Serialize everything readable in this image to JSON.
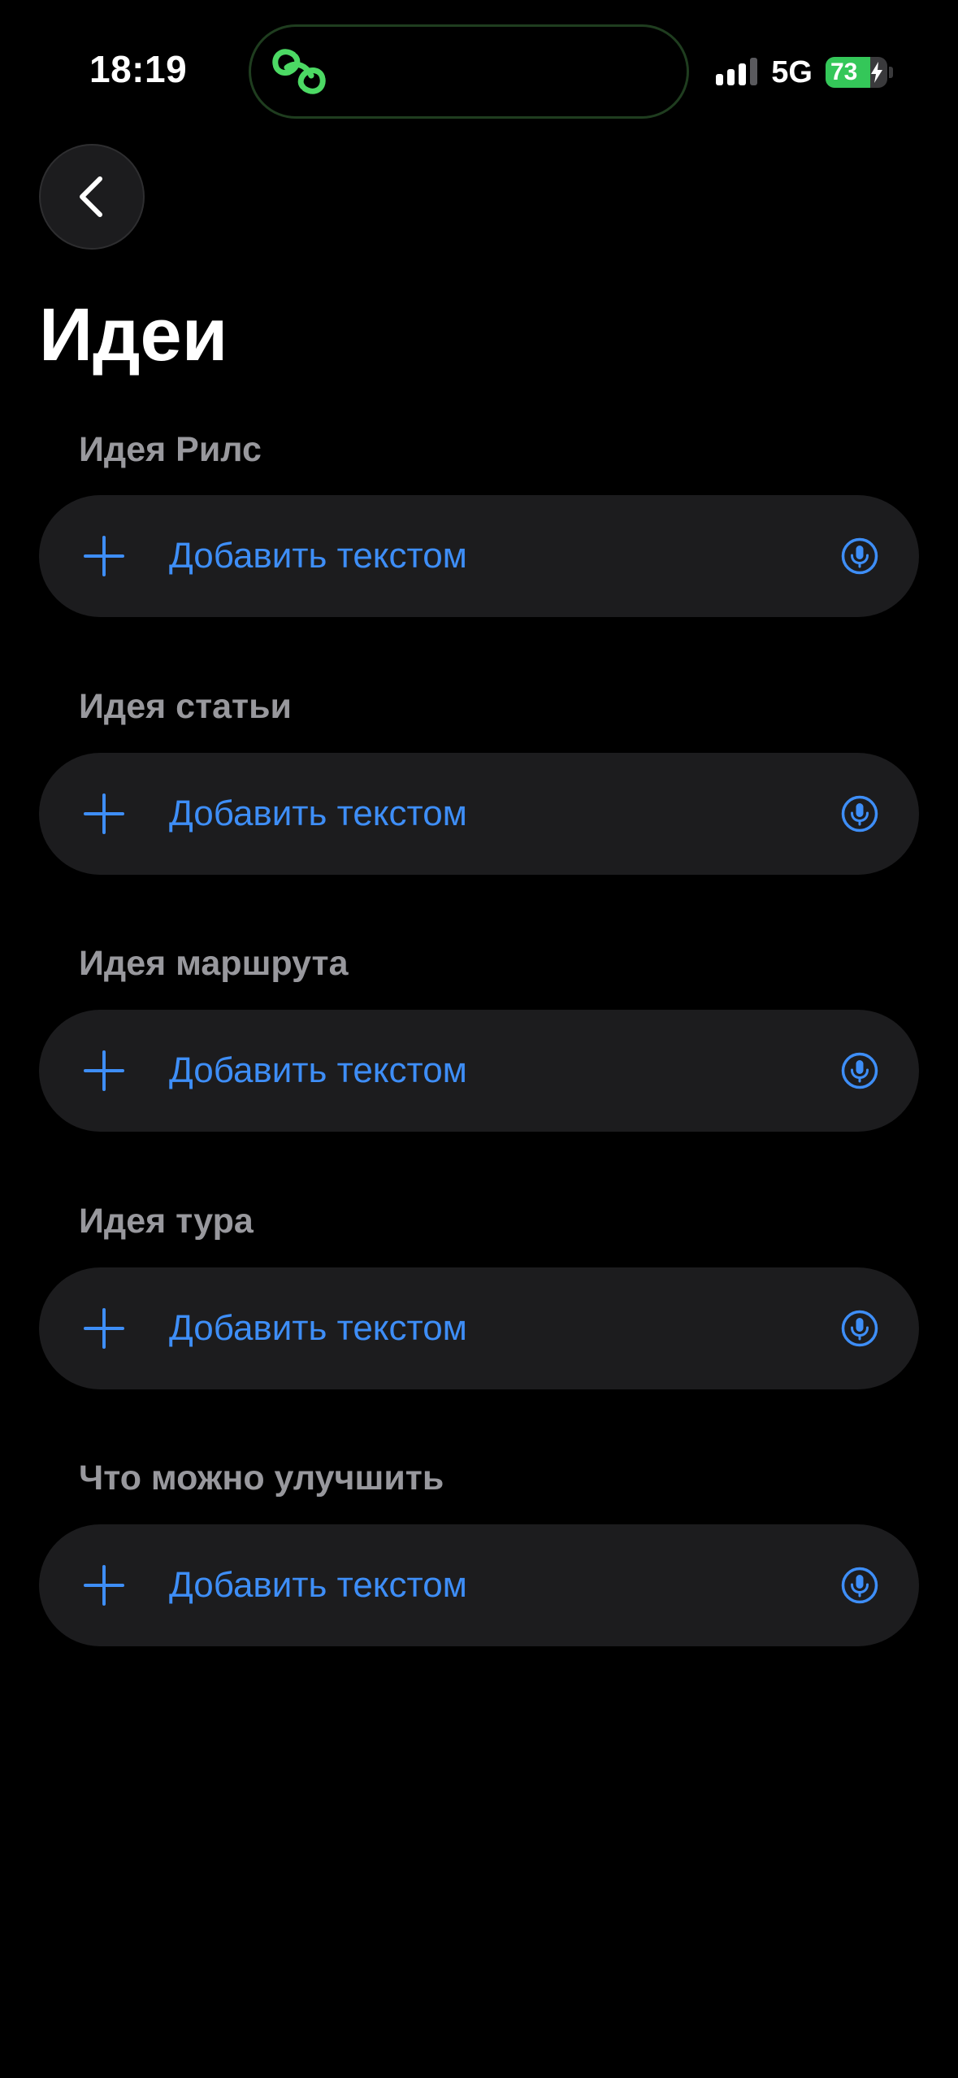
{
  "status_bar": {
    "time": "18:19",
    "network": "5G",
    "battery_percent": "73",
    "battery_level": 73
  },
  "page": {
    "title": "Идеи"
  },
  "sections": [
    {
      "label": "Идея Рилс",
      "add_label": "Добавить текстом"
    },
    {
      "label": "Идея статьи",
      "add_label": "Добавить текстом"
    },
    {
      "label": "Идея маршрута",
      "add_label": "Добавить текстом"
    },
    {
      "label": "Идея тура",
      "add_label": "Добавить текстом"
    },
    {
      "label": "Что можно улучшить",
      "add_label": "Добавить текстом"
    }
  ],
  "icons": {
    "back": "chevron-left-icon",
    "add": "plus-icon",
    "voice": "microphone-icon",
    "island": "link-chain-icon"
  },
  "colors": {
    "background": "#000000",
    "field_background": "#1c1c1e",
    "accent": "#3e8ef7",
    "section_label": "#98989d",
    "island_icon": "#4cd964",
    "battery": "#34c759"
  }
}
